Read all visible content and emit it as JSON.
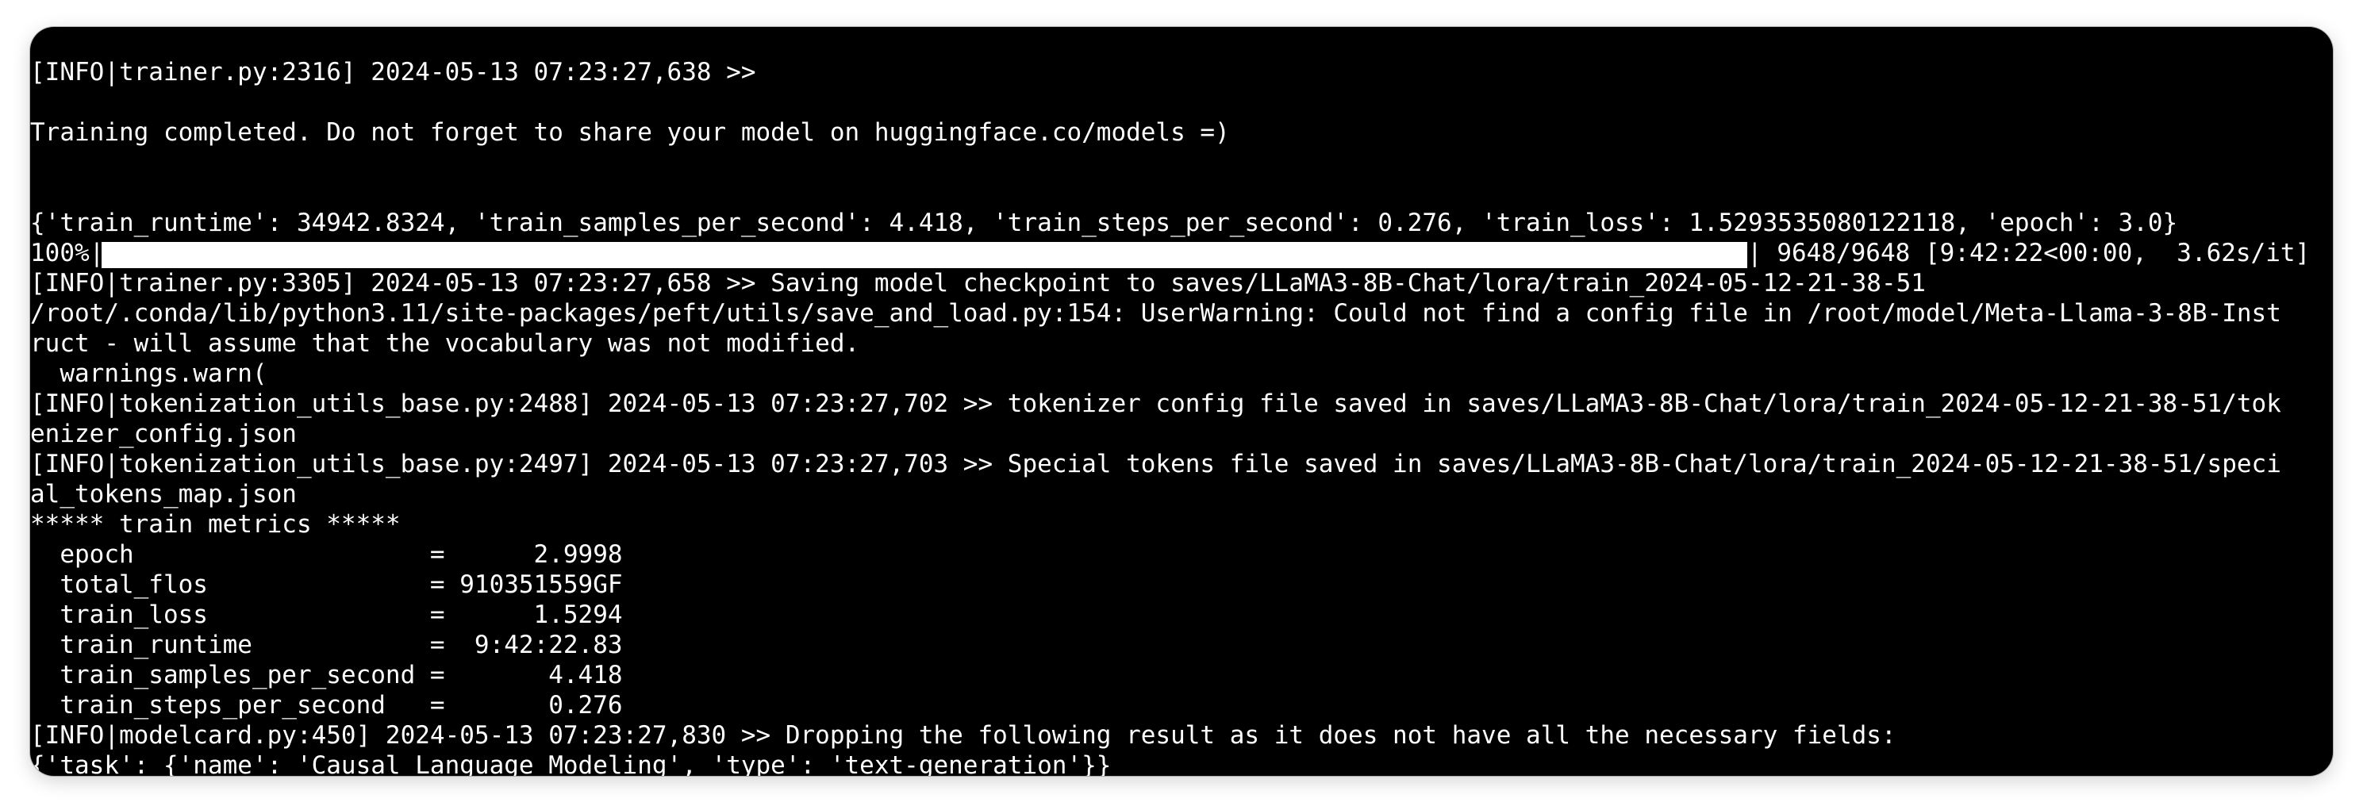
{
  "terminal": {
    "line_01": "[INFO|trainer.py:2316] 2024-05-13 07:23:27,638 >>",
    "line_02": "",
    "line_03": "Training completed. Do not forget to share your model on huggingface.co/models =)",
    "line_04": "",
    "line_05": "",
    "line_06": "{'train_runtime': 34942.8324, 'train_samples_per_second': 4.418, 'train_steps_per_second': 0.276, 'train_loss': 1.5293535080122118, 'epoch': 3.0}",
    "progress": {
      "percent_label": "100%|",
      "fraction": 1.0,
      "right_label": "| 9648/9648 [9:42:22<00:00,  3.62s/it]"
    },
    "line_08": "[INFO|trainer.py:3305] 2024-05-13 07:23:27,658 >> Saving model checkpoint to saves/LLaMA3-8B-Chat/lora/train_2024-05-12-21-38-51",
    "line_09": "/root/.conda/lib/python3.11/site-packages/peft/utils/save_and_load.py:154: UserWarning: Could not find a config file in /root/model/Meta-Llama-3-8B-Inst",
    "line_10": "ruct - will assume that the vocabulary was not modified.",
    "line_11": "  warnings.warn(",
    "line_12": "[INFO|tokenization_utils_base.py:2488] 2024-05-13 07:23:27,702 >> tokenizer config file saved in saves/LLaMA3-8B-Chat/lora/train_2024-05-12-21-38-51/tok",
    "line_13": "enizer_config.json",
    "line_14": "[INFO|tokenization_utils_base.py:2497] 2024-05-13 07:23:27,703 >> Special tokens file saved in saves/LLaMA3-8B-Chat/lora/train_2024-05-12-21-38-51/speci",
    "line_15": "al_tokens_map.json",
    "line_16": "***** train metrics *****",
    "line_17": "  epoch                    =      2.9998",
    "line_18": "  total_flos               = 910351559GF",
    "line_19": "  train_loss               =      1.5294",
    "line_20": "  train_runtime            =  9:42:22.83",
    "line_21": "  train_samples_per_second =       4.418",
    "line_22": "  train_steps_per_second   =       0.276",
    "line_23": "[INFO|modelcard.py:450] 2024-05-13 07:23:27,830 >> Dropping the following result as it does not have all the necessary fields:",
    "line_24": "{'task': {'name': 'Causal Language Modeling', 'type': 'text-generation'}}"
  }
}
